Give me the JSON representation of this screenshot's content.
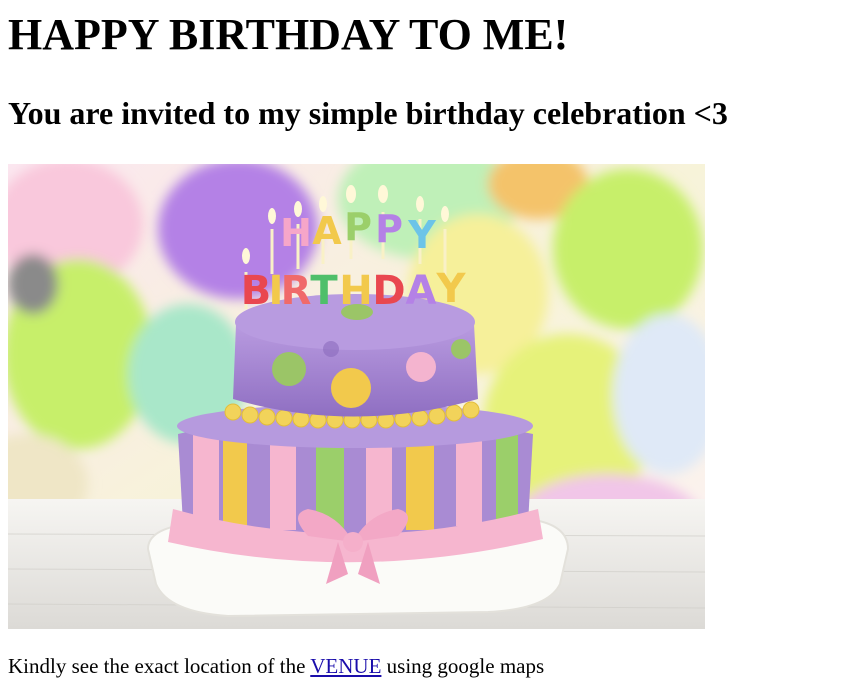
{
  "page": {
    "heading": "HAPPY BIRTHDAY TO ME!",
    "subheading": "You are invited to my simple birthday celebration <3",
    "image": {
      "candle_letters_top": [
        "H",
        "A",
        "P",
        "P",
        "Y"
      ],
      "candle_letters_bottom": [
        "B",
        "I",
        "R",
        "T",
        "H",
        "D",
        "A",
        "Y"
      ],
      "alt": "Birthday cake"
    },
    "caption": {
      "before": "Kindly see the exact location of the ",
      "link_text": "VENUE",
      "after": " using google maps"
    }
  },
  "colors": {
    "link": "#1a0dab",
    "cake_purple": "#a98bd3",
    "fondant_pink": "#f6b6cf",
    "stripe_yellow": "#f2c94c",
    "stripe_green": "#9bcf6a",
    "balloon_green": "#c7ef6b",
    "balloon_purple": "#b481e6"
  }
}
